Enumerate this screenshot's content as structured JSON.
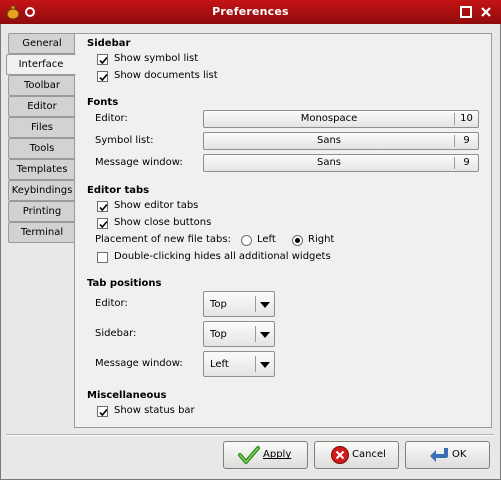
{
  "window": {
    "title": "Preferences"
  },
  "tabs": [
    {
      "label": "General"
    },
    {
      "label": "Interface"
    },
    {
      "label": "Toolbar"
    },
    {
      "label": "Editor"
    },
    {
      "label": "Files"
    },
    {
      "label": "Tools"
    },
    {
      "label": "Templates"
    },
    {
      "label": "Keybindings"
    },
    {
      "label": "Printing"
    },
    {
      "label": "Terminal"
    }
  ],
  "active_tab": "Interface",
  "sidebar": {
    "title": "Sidebar",
    "show_symbol_list": {
      "label": "Show symbol list",
      "checked": true
    },
    "show_documents_list": {
      "label": "Show documents list",
      "checked": true
    }
  },
  "fonts": {
    "title": "Fonts",
    "editor": {
      "label": "Editor:",
      "font": "Monospace",
      "size": "10"
    },
    "symbol_list": {
      "label": "Symbol list:",
      "font": "Sans",
      "size": "9"
    },
    "message_window": {
      "label": "Message window:",
      "font": "Sans",
      "size": "9"
    }
  },
  "editor_tabs": {
    "title": "Editor tabs",
    "show_editor_tabs": {
      "label": "Show editor tabs",
      "checked": true
    },
    "show_close_buttons": {
      "label": "Show close buttons",
      "checked": true
    },
    "placement_label": "Placement of new file tabs:",
    "placement_left": "Left",
    "placement_right": "Right",
    "placement_selected": "Right",
    "double_click_hides": {
      "label": "Double-clicking hides all additional widgets",
      "checked": false
    }
  },
  "tab_positions": {
    "title": "Tab positions",
    "editor": {
      "label": "Editor:",
      "value": "Top"
    },
    "sidebar": {
      "label": "Sidebar:",
      "value": "Top"
    },
    "message_window": {
      "label": "Message window:",
      "value": "Left"
    }
  },
  "misc": {
    "title": "Miscellaneous",
    "show_status_bar": {
      "label": "Show status bar",
      "checked": true
    }
  },
  "buttons": {
    "apply": "Apply",
    "cancel": "Cancel",
    "ok": "OK"
  },
  "colors": {
    "titlebar": "#b31214",
    "panel_bg": "#f0f0ef",
    "window_bg": "#e8e8e7"
  }
}
